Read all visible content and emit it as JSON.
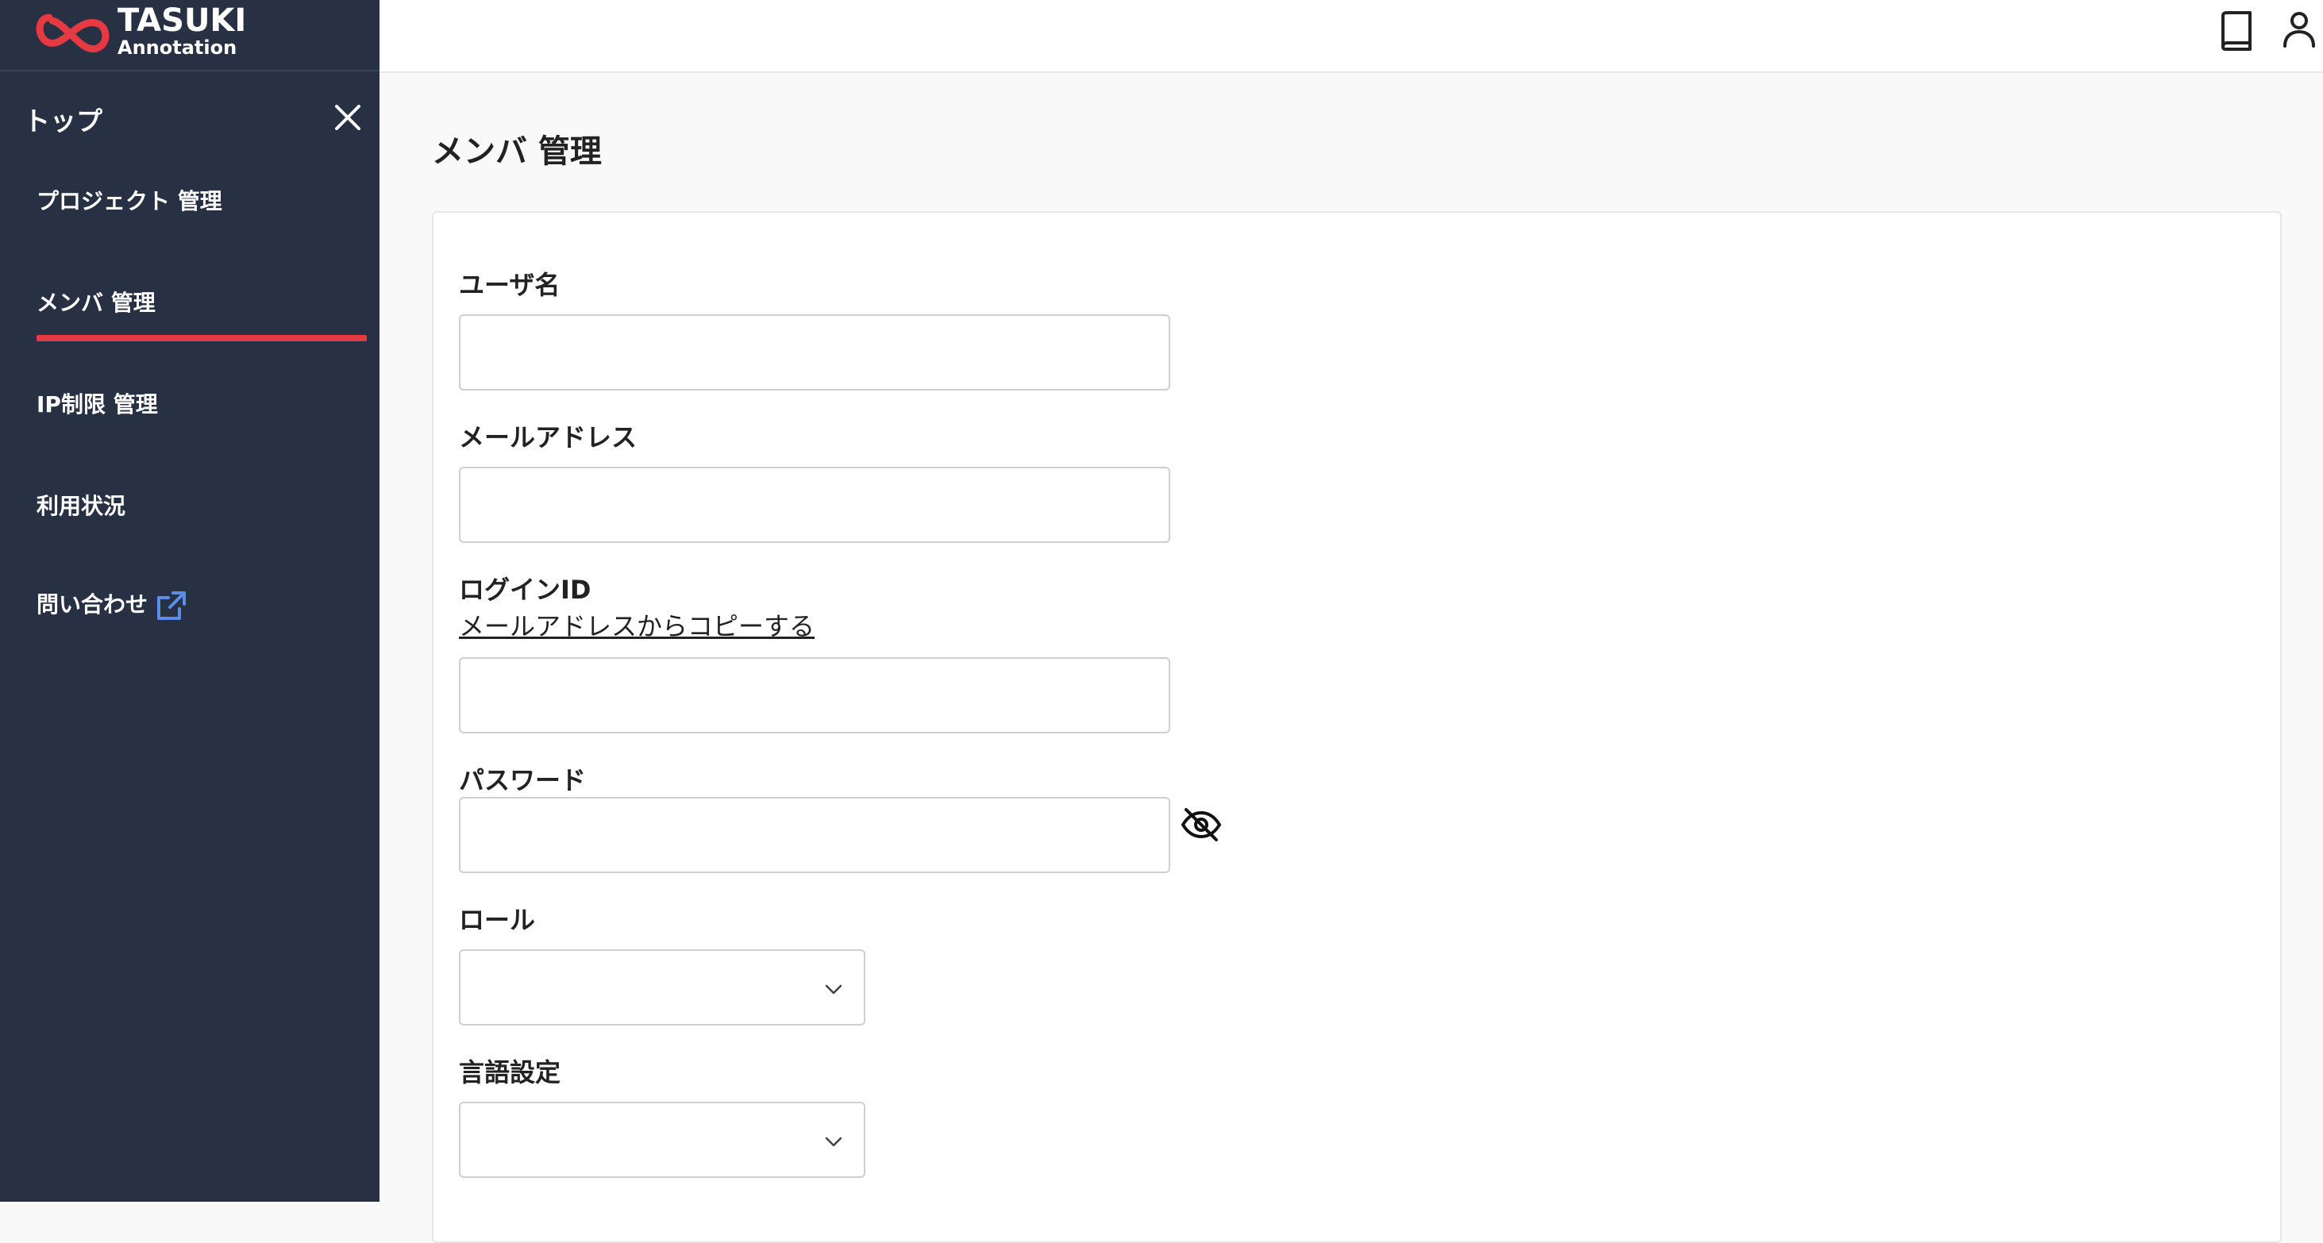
{
  "brand": {
    "name": "TASUKI",
    "sub": "Annotation",
    "accent": "#e63a43",
    "sidebar_bg": "#283044"
  },
  "sidebar": {
    "top_label": "トップ",
    "items": [
      {
        "label": "プロジェクト 管理",
        "active": false
      },
      {
        "label": "メンバ 管理",
        "active": true
      },
      {
        "label": "IP制限 管理",
        "active": false
      },
      {
        "label": "利用状況",
        "active": false
      },
      {
        "label": "問い合わせ",
        "active": false,
        "icon": "external-link-icon"
      }
    ]
  },
  "header": {
    "icons": [
      "book-icon",
      "user-icon"
    ]
  },
  "main": {
    "title": "メンバ 管理",
    "form": {
      "username_label": "ユーザ名",
      "username_value": "",
      "email_label": "メールアドレス",
      "email_value": "",
      "login_id_label": "ログインID",
      "copy_from_email_link": "メールアドレスからコピーする",
      "login_id_value": "",
      "password_label": "パスワード",
      "password_value": "",
      "role_label": "ロール",
      "role_value": "",
      "language_label": "言語設定",
      "language_value": ""
    }
  }
}
